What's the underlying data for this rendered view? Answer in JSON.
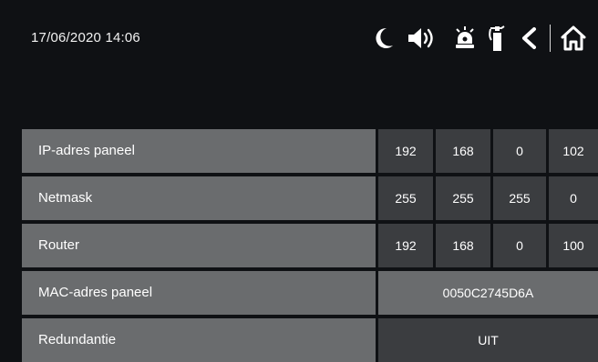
{
  "header": {
    "datetime": "17/06/2020  14:06",
    "icons": [
      "moon-icon",
      "speaker-icon",
      "siren-icon",
      "extinguisher-icon",
      "back-icon",
      "home-icon"
    ]
  },
  "network": {
    "ip": {
      "label": "IP-adres paneel",
      "octets": [
        "192",
        "168",
        "0",
        "102"
      ]
    },
    "netmask": {
      "label": "Netmask",
      "octets": [
        "255",
        "255",
        "255",
        "0"
      ]
    },
    "router": {
      "label": "Router",
      "octets": [
        "192",
        "168",
        "0",
        "100"
      ]
    },
    "mac": {
      "label": "MAC-adres paneel",
      "value": "0050C2745D6A"
    },
    "redundancy": {
      "label": "Redundantie",
      "value": "UIT"
    }
  },
  "colors": {
    "background": "#0f1114",
    "label_cell": "#6a6c6e",
    "value_cell": "#3b3d40",
    "text": "#ffffff"
  }
}
